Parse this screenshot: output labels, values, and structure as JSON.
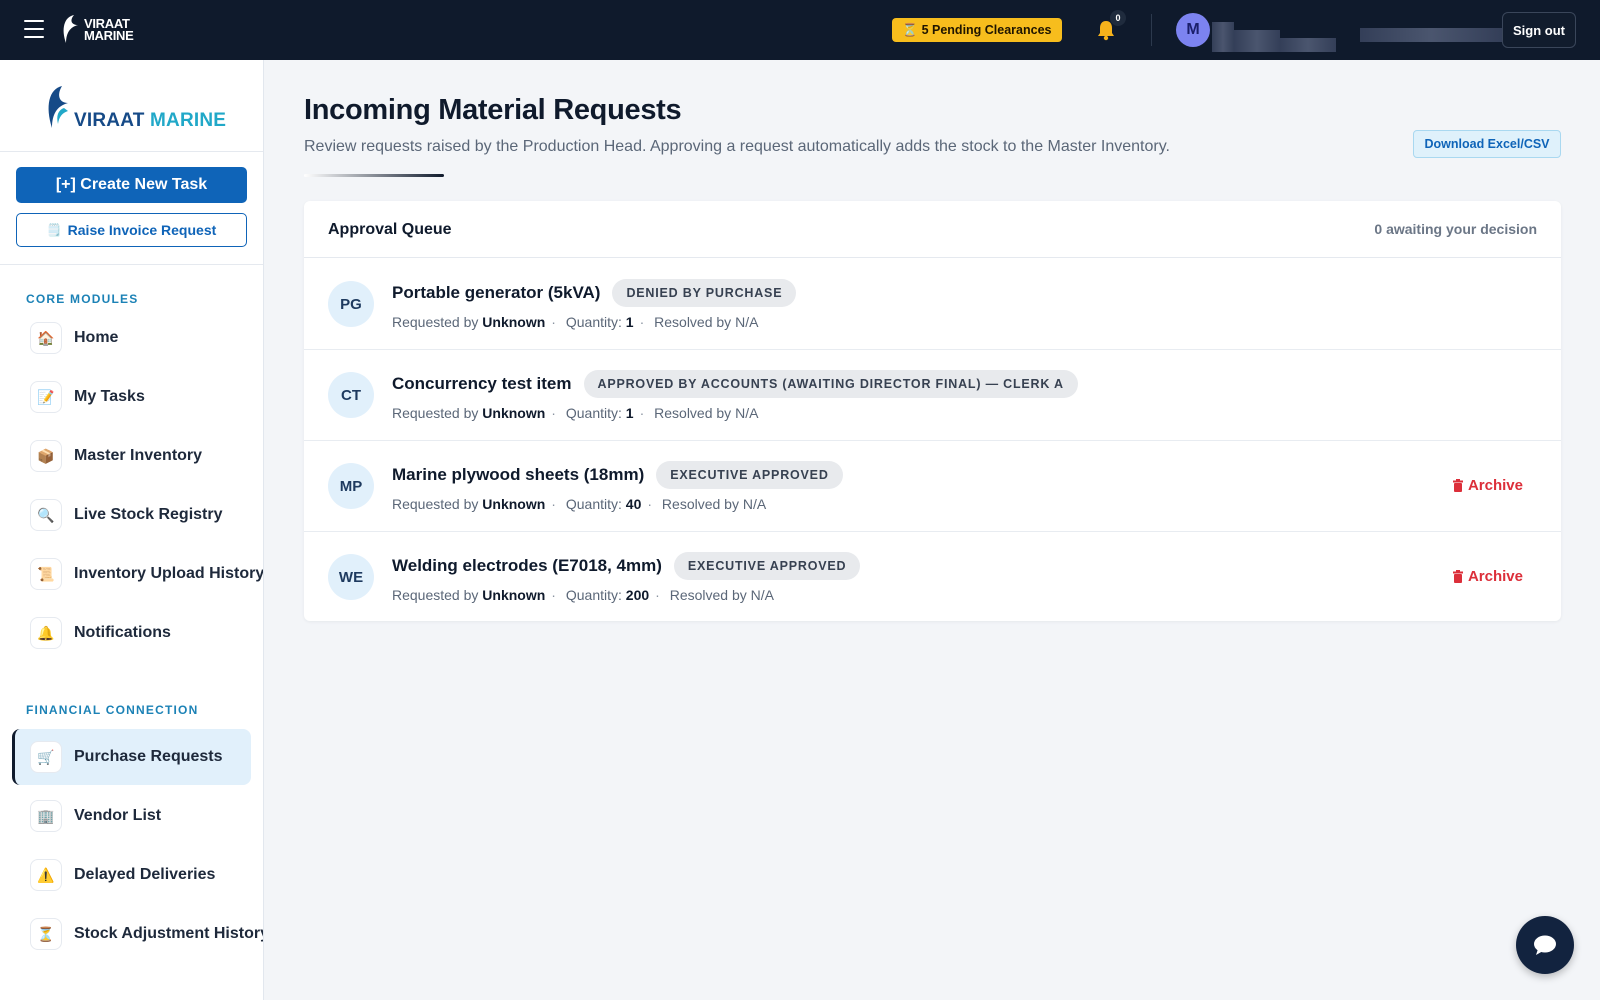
{
  "topbar": {
    "logo_text_1": "VIRAAT",
    "logo_text_2": "MARINE",
    "pending_label": "5 Pending Clearances",
    "pending_icon": "hourglass-icon",
    "notification_count": "0",
    "avatar_initial": "M",
    "signout_label": "Sign out"
  },
  "sidebar": {
    "logo_text_1": "VIRAAT",
    "logo_text_2": "MARINE",
    "create_task_label": "[+] Create New Task",
    "invoice_label": "Raise Invoice Request",
    "sections": [
      {
        "title": "CORE MODULES",
        "items": [
          {
            "label": "Home",
            "icon": "🏠",
            "active": false
          },
          {
            "label": "My Tasks",
            "icon": "📝",
            "active": false
          },
          {
            "label": "Master Inventory",
            "icon": "📦",
            "active": false
          },
          {
            "label": "Live Stock Registry",
            "icon": "🔍",
            "active": false
          },
          {
            "label": "Inventory Upload History",
            "icon": "📜",
            "active": false
          },
          {
            "label": "Notifications",
            "icon": "🔔",
            "active": false
          }
        ]
      },
      {
        "title": "FINANCIAL CONNECTION",
        "items": [
          {
            "label": "Purchase Requests",
            "icon": "🛒",
            "active": true
          },
          {
            "label": "Vendor List",
            "icon": "🏢",
            "active": false
          },
          {
            "label": "Delayed Deliveries",
            "icon": "⚠️",
            "active": false
          },
          {
            "label": "Stock Adjustment History",
            "icon": "⏳",
            "active": false
          }
        ]
      }
    ]
  },
  "main": {
    "title": "Incoming Material Requests",
    "subtitle": "Review requests raised by the Production Head. Approving a request automatically adds the stock to the Master Inventory.",
    "download_label": "Download Excel/CSV",
    "queue": {
      "title": "Approval Queue",
      "count_label": "0 awaiting your decision",
      "meta_labels": {
        "requested_by": "Requested by",
        "quantity": "Quantity:",
        "resolved_by": "Resolved by"
      },
      "archive_label": "Archive",
      "rows": [
        {
          "initials": "PG",
          "name": "Portable generator (5kVA)",
          "status": "DENIED BY PURCHASE",
          "requester": "Unknown",
          "quantity": "1",
          "resolved": "N/A",
          "archivable": false
        },
        {
          "initials": "CT",
          "name": "Concurrency test item",
          "status": "APPROVED BY ACCOUNTS (AWAITING DIRECTOR FINAL) — CLERK A",
          "requester": "Unknown",
          "quantity": "1",
          "resolved": "N/A",
          "archivable": false
        },
        {
          "initials": "MP",
          "name": "Marine plywood sheets (18mm)",
          "status": "EXECUTIVE APPROVED",
          "requester": "Unknown",
          "quantity": "40",
          "resolved": "N/A",
          "archivable": true
        },
        {
          "initials": "WE",
          "name": "Welding electrodes (E7018, 4mm)",
          "status": "EXECUTIVE APPROVED",
          "requester": "Unknown",
          "quantity": "200",
          "resolved": "N/A",
          "archivable": true
        }
      ]
    }
  },
  "colors": {
    "topbar_bg": "#0f1a2c",
    "primary": "#0f64b8",
    "accent_teal": "#21a8c8",
    "pending_yellow": "#f7bd1d",
    "archive_red": "#dc2f3a"
  }
}
